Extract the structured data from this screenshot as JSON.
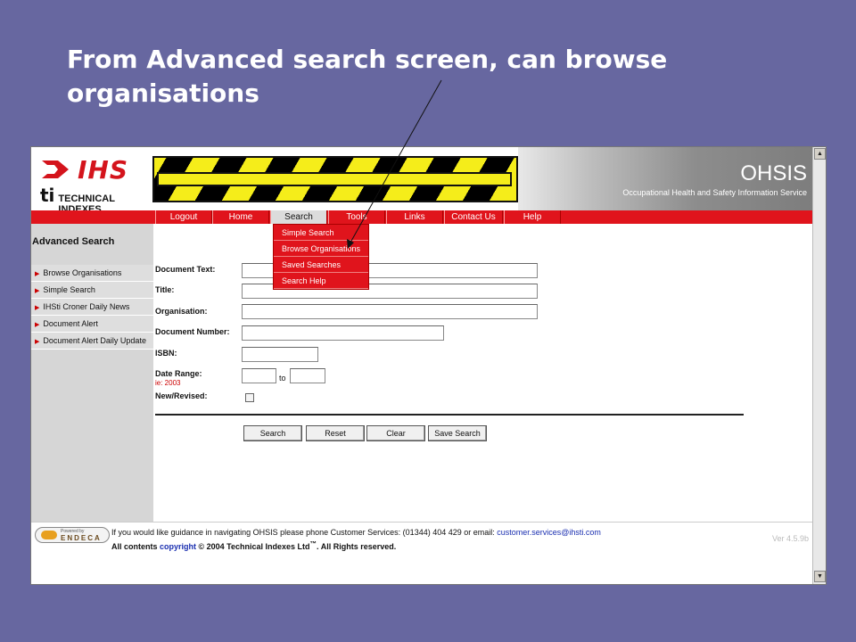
{
  "slide": {
    "title": "From Advanced search screen, can browse organisations"
  },
  "header": {
    "logo_ihs": "IHS",
    "logo_ti": "ti",
    "logo_ti_text": "TECHNICAL INDEXES",
    "banner_title": "OHSIS",
    "banner_subtitle": "Occupational Health and Safety Information Service"
  },
  "nav": {
    "tabs": [
      {
        "label": "Logout"
      },
      {
        "label": "Home"
      },
      {
        "label": "Search"
      },
      {
        "label": "Tools"
      },
      {
        "label": "Links"
      },
      {
        "label": "Contact Us"
      },
      {
        "label": "Help"
      }
    ],
    "active": "Search"
  },
  "search_menu": {
    "items": [
      {
        "label": "Simple Search"
      },
      {
        "label": "Browse Organisations"
      },
      {
        "label": "Saved Searches"
      },
      {
        "label": "Search Help"
      }
    ]
  },
  "sidebar": {
    "title": "Advanced Search",
    "items": [
      {
        "label": "Browse Organisations"
      },
      {
        "label": "Simple Search"
      },
      {
        "label": "IHSti Croner Daily News"
      },
      {
        "label": "Document Alert"
      },
      {
        "label": "Document Alert Daily Update"
      }
    ]
  },
  "form": {
    "document_text_label": "Document Text:",
    "title_label": "Title:",
    "organisation_label": "Organisation:",
    "document_number_label": "Document Number:",
    "isbn_label": "ISBN:",
    "date_range_label": "Date Range:",
    "date_range_hint": "ie: 2003",
    "to_label": "to",
    "new_revised_label": "New/Revised:",
    "new_revised_checked": false,
    "buttons": {
      "search": "Search",
      "reset": "Reset",
      "clear": "Clear",
      "save_search": "Save Search"
    }
  },
  "footer": {
    "powered_by": "Powered by",
    "endeca": "ENDECA",
    "guidance_text": "If you would like guidance in navigating OHSIS please phone Customer Services: (01344) 404 429 or email: ",
    "email": "customer.services@ihsti.com",
    "all_contents": "All contents ",
    "copyright_link": "copyright",
    "copyright_rest": " © 2004 Technical Indexes Ltd",
    "tm": "™",
    "rights": ". All Rights reserved.",
    "version": "Ver 4.5.9b"
  },
  "colors": {
    "slide_bg": "#6767a0",
    "nav_red": "#e0141c",
    "hazard_yellow": "#f5ed1a",
    "sidebar_grey": "#d6d6d6",
    "link_blue": "#1a2fb0"
  }
}
